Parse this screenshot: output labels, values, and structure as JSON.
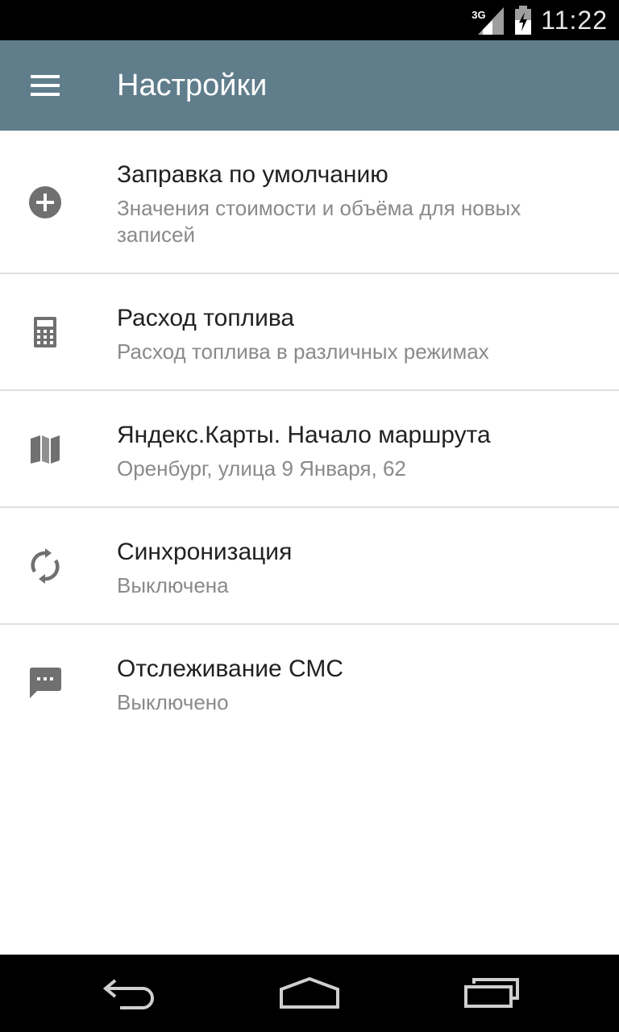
{
  "status_bar": {
    "network": "3G",
    "time": "11:22"
  },
  "app_bar": {
    "menu_icon": "hamburger-menu-icon",
    "title": "Настройки",
    "color": "#607d8b"
  },
  "settings": [
    {
      "icon": "add-circle-icon",
      "title": "Заправка по умолчанию",
      "subtitle": "Значения стоимости и объёма для новых записей"
    },
    {
      "icon": "calculator-icon",
      "title": "Расход топлива",
      "subtitle": "Расход топлива в различных режимах"
    },
    {
      "icon": "map-icon",
      "title": "Яндекс.Карты. Начало маршрута",
      "subtitle": "Оренбург, улица 9 Января, 62"
    },
    {
      "icon": "sync-icon",
      "title": "Синхронизация",
      "subtitle": "Выключена"
    },
    {
      "icon": "sms-icon",
      "title": "Отслеживание СМС",
      "subtitle": "Выключено"
    }
  ],
  "nav_bar": {
    "back_icon": "back-icon",
    "home_icon": "home-icon",
    "recents_icon": "recents-icon"
  }
}
